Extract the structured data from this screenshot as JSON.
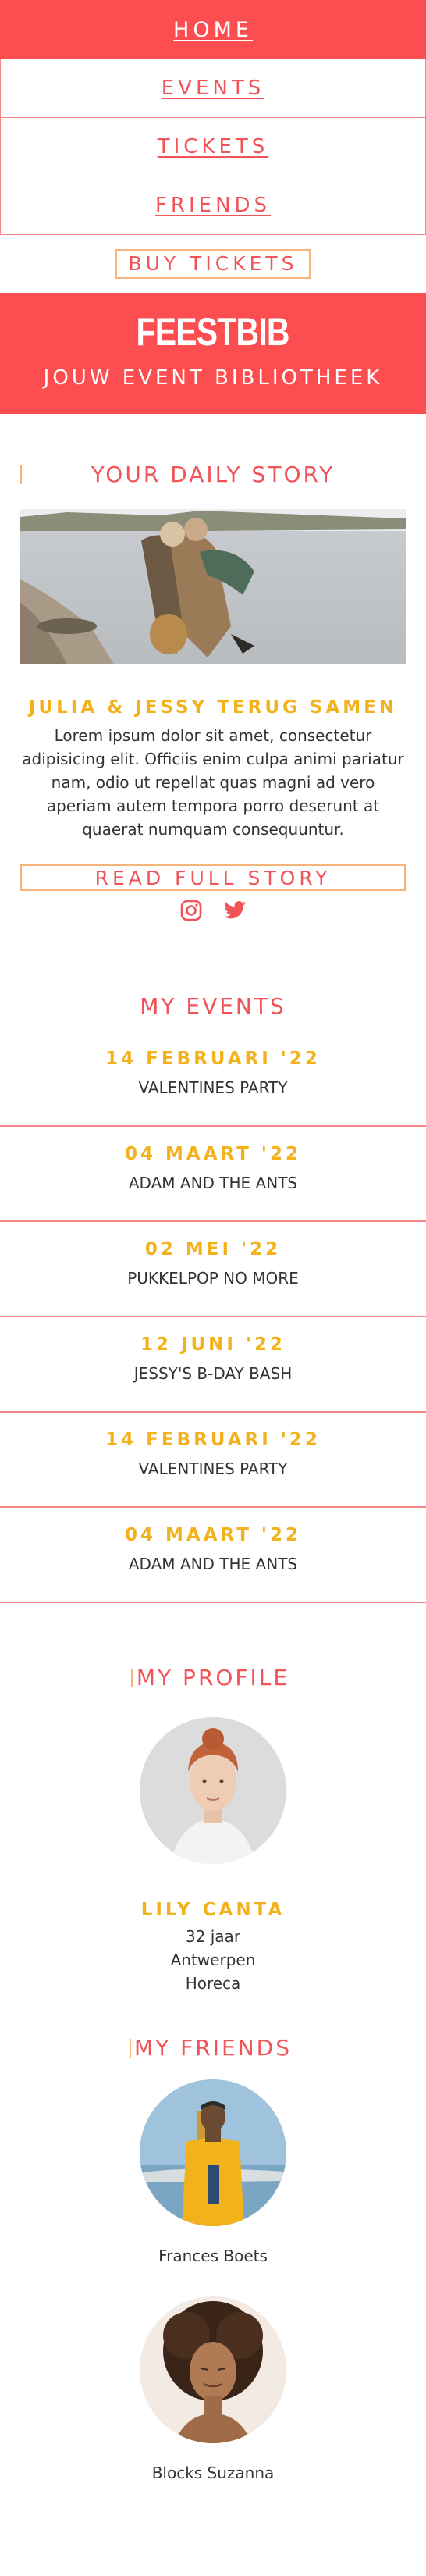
{
  "nav": {
    "home": "HOME",
    "events": "EVENTS",
    "tickets": "TICKETS",
    "friends": "FRIENDS",
    "buy_tickets": "BUY TICKETS"
  },
  "hero": {
    "brand": "FEESTBIB",
    "tagline": "JOUW EVENT BIBLIOTHEEK"
  },
  "story": {
    "heading": "YOUR DAILY STORY",
    "title": "JULIA & JESSY TERUG SAMEN",
    "text": "Lorem ipsum dolor sit amet, consectetur adipisicing elit. Officiis enim culpa animi pariatur nam, odio ut repellat quas magni ad vero aperiam autem tempora porro deserunt at quaerat numquam consequuntur.",
    "read_more": "READ FULL STORY",
    "social": [
      "instagram-icon",
      "twitter-icon"
    ]
  },
  "events": {
    "heading": "MY EVENTS",
    "items": [
      {
        "date": "14 FEBRUARI '22",
        "name": "VALENTINES PARTY"
      },
      {
        "date": "04 MAART '22",
        "name": "ADAM AND THE ANTS"
      },
      {
        "date": "02 MEI '22",
        "name": "PUKKELPOP NO MORE"
      },
      {
        "date": "12 JUNI '22",
        "name": "JESSY'S B-DAY BASH"
      },
      {
        "date": "14 FEBRUARI '22",
        "name": "VALENTINES PARTY"
      },
      {
        "date": "04 MAART '22",
        "name": "ADAM AND THE ANTS"
      }
    ]
  },
  "profile": {
    "heading": "MY PROFILE",
    "name": "LILY CANTA",
    "age": "32 jaar",
    "city": "Antwerpen",
    "sector": "Horeca"
  },
  "friends": {
    "heading": "MY FRIENDS",
    "items": [
      {
        "name": "Frances Boets"
      },
      {
        "name": "Blocks Suzanna"
      }
    ]
  },
  "colors": {
    "accent": "#fc4e50",
    "accent_text": "#f05358",
    "gold": "#f3b11c",
    "border_soft": "#f5868a",
    "border_gold": "#f4b47a"
  }
}
